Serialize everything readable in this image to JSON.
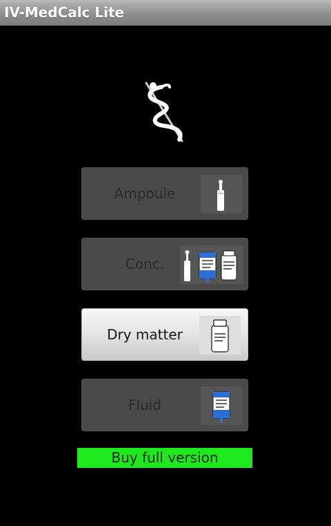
{
  "app": {
    "title": "IV-MedCalc Lite"
  },
  "logo": {
    "icon": "caduceus-snake-icon"
  },
  "menu": {
    "ampoule_label": "Ampoule",
    "conc_label": "Conc.",
    "dry_matter_label": "Dry matter",
    "fluid_label": "Fluid"
  },
  "buy": {
    "label": "Buy full version"
  },
  "colors": {
    "buy_bg": "#1ee81e",
    "bag_blue": "#2c6fd6",
    "inactive_btn": "#4a4a4a"
  }
}
